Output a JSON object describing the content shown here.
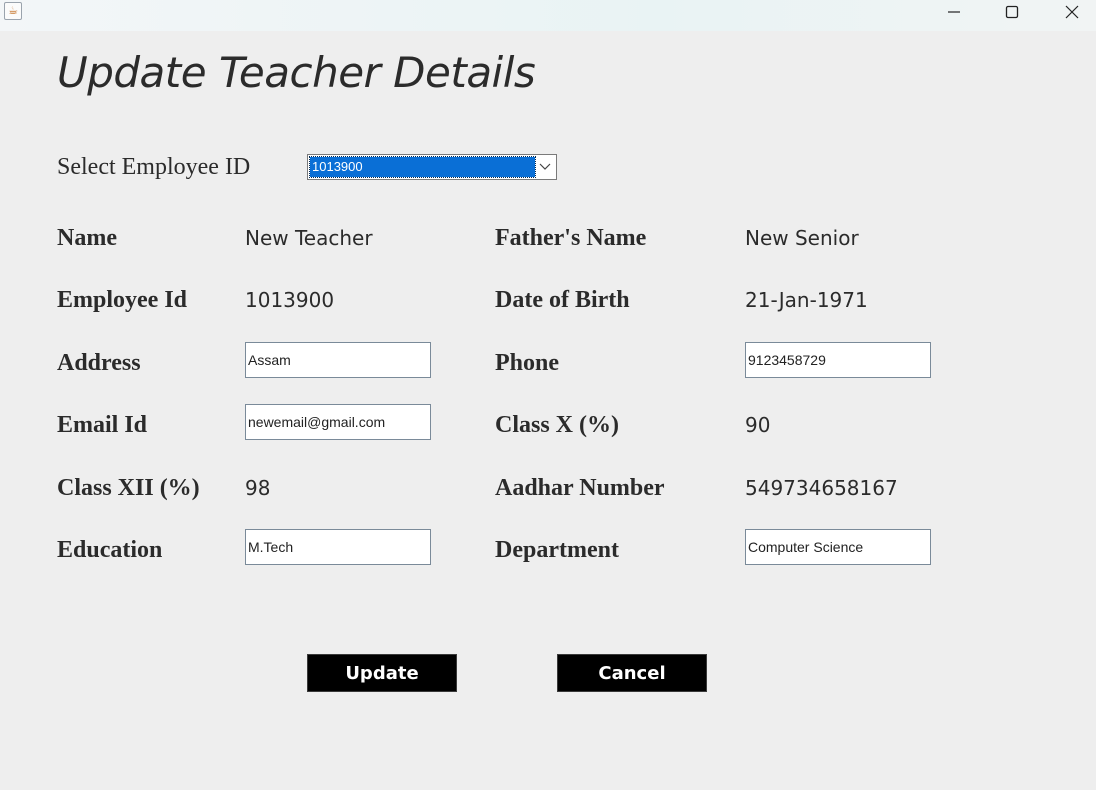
{
  "window": {
    "app_icon": "java-cup-icon",
    "controls": [
      "minimize-icon",
      "maximize-icon",
      "close-icon"
    ]
  },
  "form": {
    "title": "Update Teacher Details",
    "select_label": "Select Employee ID",
    "selected_employee_id": "1013900",
    "name_label": "Name",
    "name_value": "New Teacher",
    "father_label": "Father's Name",
    "father_value": "New Senior",
    "empid_label": "Employee Id",
    "empid_value": "1013900",
    "dob_label": "Date of Birth",
    "dob_value": "21-Jan-1971",
    "address_label": "Address",
    "address_value": "Assam",
    "phone_label": "Phone",
    "phone_value": "9123458729",
    "email_label": "Email Id",
    "email_value": "newemail@gmail.com",
    "classx_label": "Class X (%)",
    "classx_value": "90",
    "classxii_label": "Class XII (%)",
    "classxii_value": "98",
    "aadhar_label": "Aadhar Number",
    "aadhar_value": "549734658167",
    "education_label": "Education",
    "education_value": "M.Tech",
    "department_label": "Department",
    "department_value": "Computer Science",
    "update_label": "Update",
    "cancel_label": "Cancel"
  },
  "colors": {
    "background": "#eeeeee",
    "selection": "#0a6fd6",
    "button_bg": "#000000",
    "button_text": "#ffffff"
  }
}
